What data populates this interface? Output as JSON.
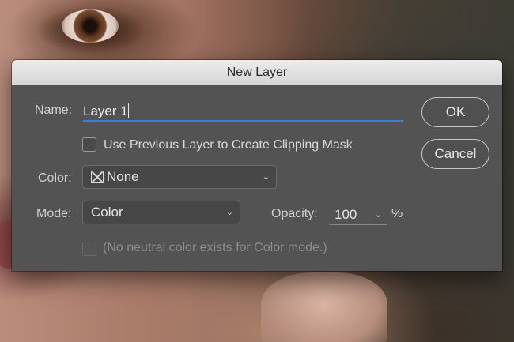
{
  "dialog": {
    "title": "New Layer",
    "name_label": "Name:",
    "name_value": "Layer 1",
    "clipping_mask_label": "Use Previous Layer to Create Clipping Mask",
    "clipping_mask_checked": false,
    "color_label": "Color:",
    "color_value": "None",
    "mode_label": "Mode:",
    "mode_value": "Color",
    "opacity_label": "Opacity:",
    "opacity_value": "100",
    "opacity_unit": "%",
    "neutral_label": "(No neutral color exists for Color mode.)",
    "neutral_checked": false,
    "ok_label": "OK",
    "cancel_label": "Cancel"
  },
  "icons": {
    "color_swatch": "x-box-icon",
    "dropdown": "chevron-down-icon"
  },
  "colors": {
    "accent": "#3b7fd6",
    "dialog_bg": "#535353",
    "titlebar_bg": "#e0e0e0"
  }
}
